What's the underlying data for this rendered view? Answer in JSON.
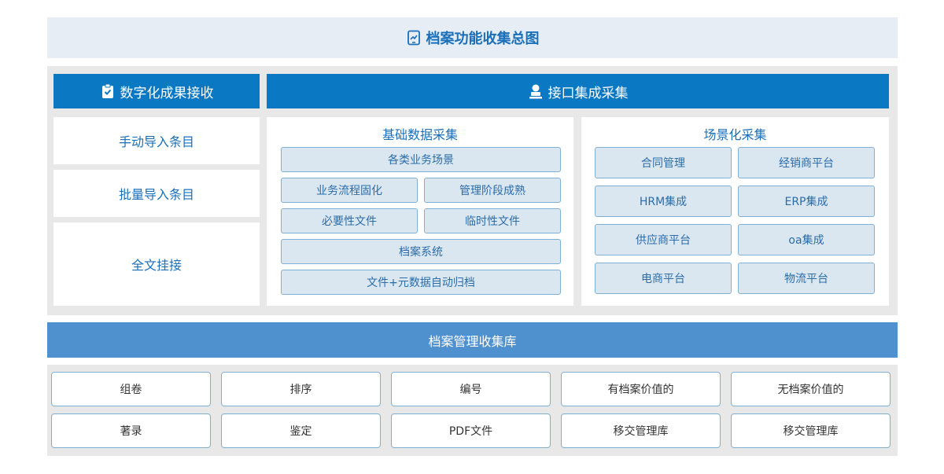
{
  "title": "档案功能收集总图",
  "left_header": "数字化成果接收",
  "right_header": "接口集成采集",
  "left_items": [
    "手动导入条目",
    "批量导入条目",
    "全文挂接"
  ],
  "basic": {
    "title": "基础数据采集",
    "items": [
      "各类业务场景",
      "业务流程固化",
      "管理阶段成熟",
      "必要性文件",
      "临时性文件",
      "档案系统",
      "文件+元数据自动归档"
    ]
  },
  "scene": {
    "title": "场景化采集",
    "items": [
      "合同管理",
      "经销商平台",
      "HRM集成",
      "ERP集成",
      "供应商平台",
      "oa集成",
      "电商平台",
      "物流平台"
    ]
  },
  "library_bar": "档案管理收集库",
  "bottom_items": [
    "组卷",
    "排序",
    "编号",
    "有档案价值的",
    "无档案价值的",
    "著录",
    "鉴定",
    "PDF文件",
    "移交管理库",
    "移交管理库"
  ],
  "colors": {
    "primary": "#0a78c2",
    "accent_text": "#1a6fb8",
    "library_bar": "#4f91cf",
    "cell_bg": "#dbe7f0",
    "cell_border": "#7fb0d6"
  },
  "icons": {
    "title": "tablet-chart-icon",
    "left_header": "clipboard-check-icon",
    "right_header": "user-stamp-icon"
  }
}
